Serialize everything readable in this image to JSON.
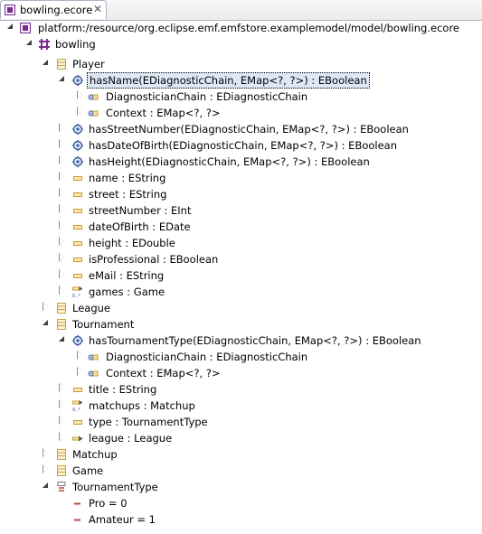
{
  "tab": {
    "title": "bowling.ecore",
    "close": "✕"
  },
  "tree": {
    "resource": "platform:/resource/org.eclipse.emf.emfstore.examplemodel/model/bowling.ecore",
    "package": "bowling",
    "items": [
      {
        "id": "player",
        "label": "Player"
      },
      {
        "id": "hasName",
        "label": "hasName(EDiagnosticChain, EMap<?, ?>) : EBoolean"
      },
      {
        "id": "hasName-p1",
        "label": "DiagnosticianChain : EDiagnosticChain"
      },
      {
        "id": "hasName-p2",
        "label": "Context : EMap<?, ?>"
      },
      {
        "id": "hasStreetNumber",
        "label": "hasStreetNumber(EDiagnosticChain, EMap<?, ?>) : EBoolean"
      },
      {
        "id": "hasDateOfBirth",
        "label": "hasDateOfBirth(EDiagnosticChain, EMap<?, ?>) : EBoolean"
      },
      {
        "id": "hasHeight",
        "label": "hasHeight(EDiagnosticChain, EMap<?, ?>) : EBoolean"
      },
      {
        "id": "name",
        "label": "name : EString"
      },
      {
        "id": "street",
        "label": "street : EString"
      },
      {
        "id": "streetNumber",
        "label": "streetNumber : EInt"
      },
      {
        "id": "dateOfBirth",
        "label": "dateOfBirth : EDate"
      },
      {
        "id": "height",
        "label": "height : EDouble"
      },
      {
        "id": "isProfessional",
        "label": "isProfessional : EBoolean"
      },
      {
        "id": "eMail",
        "label": "eMail : EString"
      },
      {
        "id": "games",
        "label": "games : Game"
      },
      {
        "id": "league",
        "label": "League"
      },
      {
        "id": "tournament",
        "label": "Tournament"
      },
      {
        "id": "hasTournamentType",
        "label": "hasTournamentType(EDiagnosticChain, EMap<?, ?>) : EBoolean"
      },
      {
        "id": "htt-p1",
        "label": "DiagnosticianChain : EDiagnosticChain"
      },
      {
        "id": "htt-p2",
        "label": "Context : EMap<?, ?>"
      },
      {
        "id": "title",
        "label": "title : EString"
      },
      {
        "id": "matchups",
        "label": "matchups : Matchup"
      },
      {
        "id": "type",
        "label": "type : TournamentType"
      },
      {
        "id": "leagueRef",
        "label": "league : League"
      },
      {
        "id": "matchup",
        "label": "Matchup"
      },
      {
        "id": "game",
        "label": "Game"
      },
      {
        "id": "tournamentType",
        "label": "TournamentType"
      },
      {
        "id": "pro",
        "label": "Pro = 0"
      },
      {
        "id": "amateur",
        "label": "Amateur = 1"
      }
    ]
  },
  "colors": {
    "selection": "#dde8f7",
    "package": "#7b2d8f",
    "class": "#c8a43c",
    "operation": "#3a5aa0",
    "attribute": "#c89b2c",
    "literal": "#b03a2e"
  }
}
